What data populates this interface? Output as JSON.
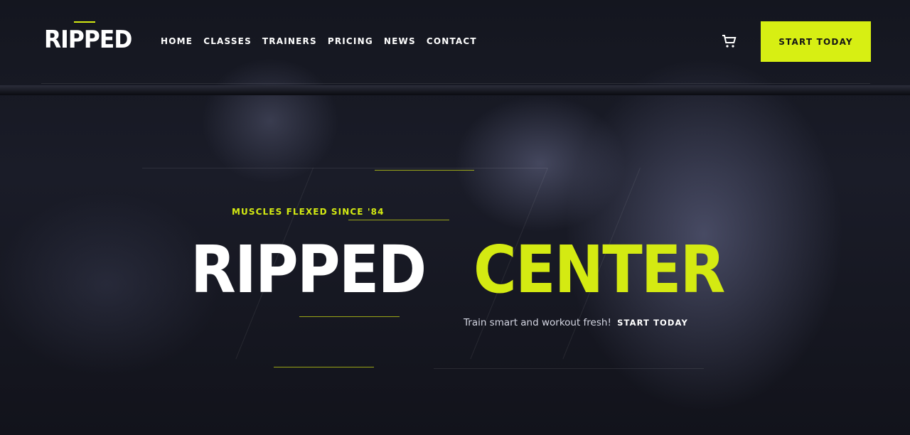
{
  "brand": {
    "logo_text": "RIPPED",
    "accent_color": "#d7ef13"
  },
  "nav": {
    "items": [
      "HOME",
      "CLASSES",
      "TRAINERS",
      "PRICING",
      "NEWS",
      "CONTACT"
    ]
  },
  "header": {
    "cta_label": "START TODAY",
    "cart_icon": "cart-icon"
  },
  "hero": {
    "eyebrow": "MUSCLES FLEXED SINCE '84",
    "title_white": "RIPPED",
    "title_accent": "CENTER",
    "subtitle": "Train smart and workout fresh!",
    "subtitle_cta": "START TODAY"
  }
}
